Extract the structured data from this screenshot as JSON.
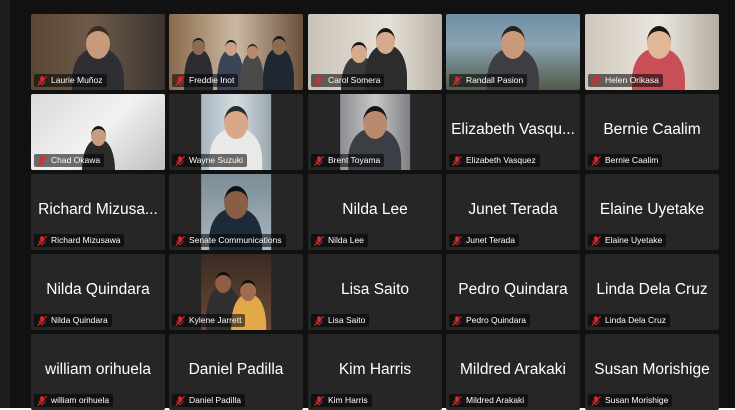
{
  "meeting": {
    "muted_icon": "muted-microphone-icon",
    "muted_icon_color": "#e02828",
    "tile_color": "#262626",
    "background_color": "#111111"
  },
  "participants": [
    {
      "name": "Laurie Muñoz",
      "video": true,
      "big_label": ""
    },
    {
      "name": "Freddie Inot",
      "video": true,
      "big_label": ""
    },
    {
      "name": "Carol Somera",
      "video": true,
      "big_label": ""
    },
    {
      "name": "Randall Pasion",
      "video": true,
      "big_label": ""
    },
    {
      "name": "Helen Orikasa",
      "video": true,
      "big_label": ""
    },
    {
      "name": "Chad Okawa",
      "video": true,
      "big_label": ""
    },
    {
      "name": "Wayne Suzuki",
      "video": true,
      "big_label": ""
    },
    {
      "name": "Brent Toyama",
      "video": true,
      "big_label": ""
    },
    {
      "name": "Elizabeth Vasquez",
      "video": false,
      "big_label": "Elizabeth Vasqu..."
    },
    {
      "name": "Bernie Caalim",
      "video": false,
      "big_label": "Bernie Caalim"
    },
    {
      "name": "Richard Mizusawa",
      "video": false,
      "big_label": "Richard Mizusa..."
    },
    {
      "name": "Senate Communications",
      "video": true,
      "big_label": ""
    },
    {
      "name": "Nilda Lee",
      "video": false,
      "big_label": "Nilda Lee"
    },
    {
      "name": "Junet Terada",
      "video": false,
      "big_label": "Junet Terada"
    },
    {
      "name": "Elaine Uyetake",
      "video": false,
      "big_label": "Elaine Uyetake"
    },
    {
      "name": "Nilda Quindara",
      "video": false,
      "big_label": "Nilda Quindara"
    },
    {
      "name": "Kylene Jarrett",
      "video": true,
      "big_label": ""
    },
    {
      "name": "Lisa Saito",
      "video": false,
      "big_label": "Lisa Saito"
    },
    {
      "name": "Pedro Quindara",
      "video": false,
      "big_label": "Pedro Quindara"
    },
    {
      "name": "Linda Dela Cruz",
      "video": false,
      "big_label": "Linda Dela Cruz"
    },
    {
      "name": "william orihuela",
      "video": false,
      "big_label": "william orihuela"
    },
    {
      "name": "Daniel Padilla",
      "video": false,
      "big_label": "Daniel Padilla"
    },
    {
      "name": "Kim Harris",
      "video": false,
      "big_label": "Kim Harris"
    },
    {
      "name": "Mildred Arakaki",
      "video": false,
      "big_label": "Mildred Arakaki"
    },
    {
      "name": "Susan Morishige",
      "video": false,
      "big_label": "Susan Morishige"
    }
  ]
}
